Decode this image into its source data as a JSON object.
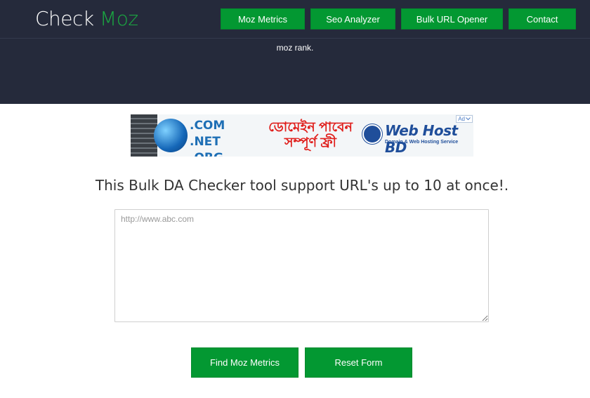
{
  "header": {
    "logo_text": "Check",
    "logo_accent": "Moz",
    "subtitle": "moz rank.",
    "nav": [
      {
        "label": "Moz Metrics"
      },
      {
        "label": "Seo Analyzer"
      },
      {
        "label": "Bulk URL Opener"
      },
      {
        "label": "Contact"
      }
    ]
  },
  "ad": {
    "domains_line1": ".COM .NET",
    "domains_line2": ".ORG .INFO",
    "bangla_line1": "ডোমেইন পাবেন",
    "bangla_line2": "সম্পূর্ণ ফ্রী",
    "brand": "Web Host BD",
    "tagline": "Domain & Web Hosting Service",
    "badge": "Ad"
  },
  "main": {
    "headline": "This Bulk DA Checker tool support URL's up to 10 at once!.",
    "url_placeholder": "http://www.abc.com",
    "find_button": "Find Moz Metrics",
    "reset_button": "Reset Form"
  },
  "colors": {
    "header_bg": "#252a3b",
    "accent_green": "#039832",
    "logo_accent": "#1aa841"
  }
}
